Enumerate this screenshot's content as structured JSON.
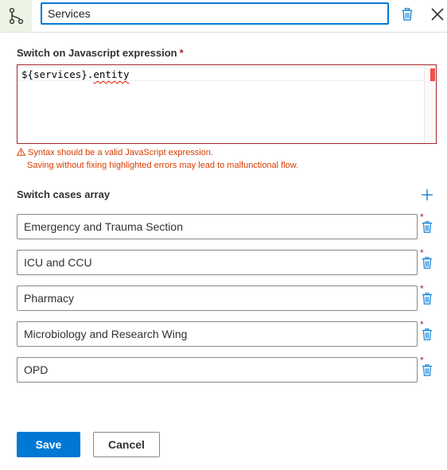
{
  "header": {
    "node_icon": "branch-icon",
    "title_value": "Services",
    "delete_icon": "trash-icon",
    "close_icon": "close-icon"
  },
  "expression": {
    "label": "Switch on Javascript expression",
    "required_marker": "*",
    "code_prefix": "${services}.",
    "code_error_token": "entity",
    "error_line1": "Syntax should be a valid JavaScript expression.",
    "error_line2": "Saving without fixing highlighted errors may lead to malfunctional flow.",
    "error_icon": "warning-icon"
  },
  "cases": {
    "label": "Switch cases array",
    "add_icon": "plus-icon",
    "required_marker": "*",
    "items": [
      {
        "value": "Emergency and Trauma Section"
      },
      {
        "value": "ICU and CCU"
      },
      {
        "value": "Pharmacy"
      },
      {
        "value": "Microbiology and Research Wing"
      },
      {
        "value": "OPD"
      }
    ]
  },
  "footer": {
    "save_label": "Save",
    "cancel_label": "Cancel"
  },
  "colors": {
    "accent": "#0078d4",
    "error": "#a4262c",
    "warning_text": "#d83b01",
    "node_icon_bg": "#eef4e5"
  }
}
